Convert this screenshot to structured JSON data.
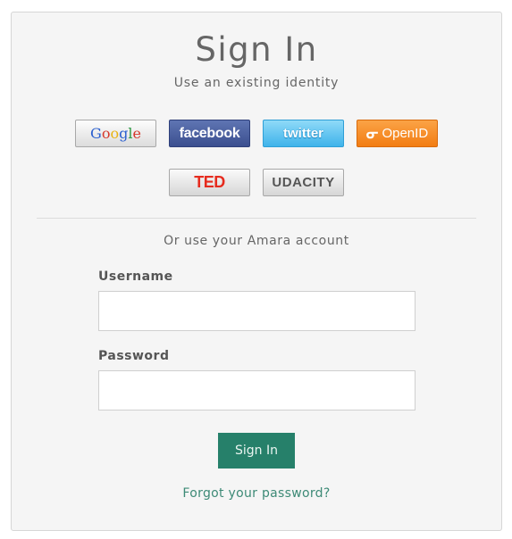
{
  "header": {
    "title": "Sign In",
    "subtitle": "Use an existing identity"
  },
  "providers": {
    "google": {
      "label_letters": [
        "G",
        "o",
        "o",
        "g",
        "l",
        "e"
      ],
      "letter_colors": [
        "#2a5fcf",
        "#d6382c",
        "#e9b313",
        "#2a5fcf",
        "#2f9a45",
        "#d6382c"
      ]
    },
    "facebook": {
      "label": "facebook"
    },
    "twitter": {
      "label": "twitter"
    },
    "openid": {
      "label": "OpenID",
      "icon": "openid-icon"
    },
    "ted": {
      "label": "TED"
    },
    "udacity": {
      "label": "UDACITY"
    }
  },
  "amara": {
    "or_text": "Or use your Amara account",
    "username_label": "Username",
    "username_value": "",
    "password_label": "Password",
    "password_value": "",
    "signin_label": "Sign In",
    "forgot_label": "Forgot your password?"
  },
  "colors": {
    "accent": "#26806a",
    "link": "#3d8a76",
    "panel_bg": "#f5f5f5"
  }
}
